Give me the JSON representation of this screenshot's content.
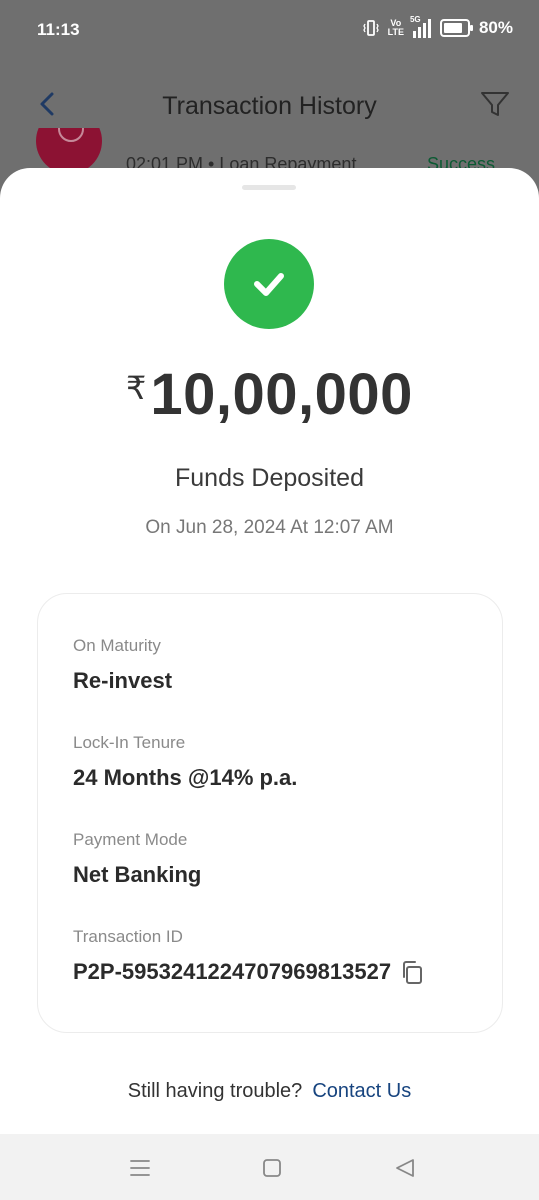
{
  "status_bar": {
    "time": "11:13",
    "volte": [
      "Vo",
      "LTE"
    ],
    "network": "5G",
    "battery_level": 0.8,
    "battery_percent": "80%"
  },
  "header": {
    "title": "Transaction History",
    "back_icon": "chevron-left-icon",
    "filter_icon": "filter-icon"
  },
  "background_row": {
    "time_type": "02:01 PM  •  Loan Repayment",
    "status": "Success"
  },
  "sheet": {
    "status_icon": "check-icon",
    "status_color": "#2fb84e",
    "currency_symbol": "₹",
    "amount": "10,00,000",
    "title": "Funds Deposited",
    "date": "On Jun 28, 2024 At 12:07 AM",
    "details": [
      {
        "label": "On Maturity",
        "value": "Re-invest"
      },
      {
        "label": "Lock-In Tenure",
        "value": "24 Months @14% p.a."
      },
      {
        "label": "Payment Mode",
        "value": "Net Banking"
      },
      {
        "label": "Transaction ID",
        "value": "P2P-595324122470796981352 7"
      }
    ],
    "help_text": "Still having trouble?",
    "contact_link": "Contact Us",
    "link_color": "#17447f"
  },
  "nav_bar": {
    "menu_icon": "menu-icon",
    "home_icon": "home-square-icon",
    "back_icon": "back-triangle-icon"
  }
}
